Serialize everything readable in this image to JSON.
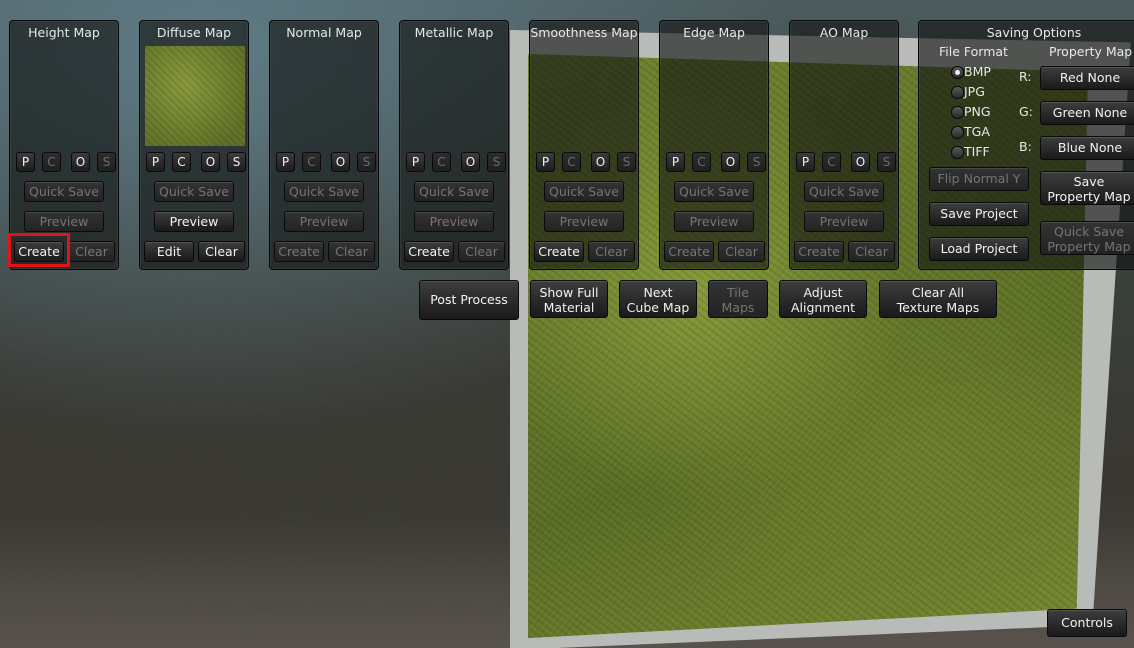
{
  "panels": [
    {
      "title": "Height Map",
      "toggles": [
        "P",
        "C",
        "O",
        "S"
      ],
      "quick_save": "Quick Save",
      "preview": "Preview",
      "create": "Create",
      "clear": "Clear"
    },
    {
      "title": "Diffuse Map",
      "toggles": [
        "P",
        "C",
        "O",
        "S"
      ],
      "quick_save": "Quick Save",
      "preview": "Preview",
      "create": "Edit",
      "clear": "Clear"
    },
    {
      "title": "Normal Map",
      "toggles": [
        "P",
        "C",
        "O",
        "S"
      ],
      "quick_save": "Quick Save",
      "preview": "Preview",
      "create": "Create",
      "clear": "Clear"
    },
    {
      "title": "Metallic Map",
      "toggles": [
        "P",
        "C",
        "O",
        "S"
      ],
      "quick_save": "Quick Save",
      "preview": "Preview",
      "create": "Create",
      "clear": "Clear"
    },
    {
      "title": "Smoothness Map",
      "toggles": [
        "P",
        "C",
        "O",
        "S"
      ],
      "quick_save": "Quick Save",
      "preview": "Preview",
      "create": "Create",
      "clear": "Clear"
    },
    {
      "title": "Edge Map",
      "toggles": [
        "P",
        "C",
        "O",
        "S"
      ],
      "quick_save": "Quick Save",
      "preview": "Preview",
      "create": "Create",
      "clear": "Clear"
    },
    {
      "title": "AO Map",
      "toggles": [
        "P",
        "C",
        "O",
        "S"
      ],
      "quick_save": "Quick Save",
      "preview": "Preview",
      "create": "Create",
      "clear": "Clear"
    }
  ],
  "saving": {
    "title": "Saving Options",
    "file_format_label": "File Format",
    "property_map_label": "Property Map",
    "formats": [
      "BMP",
      "JPG",
      "PNG",
      "TGA",
      "TIFF"
    ],
    "selected_format": "BMP",
    "channels": [
      {
        "label": "R:",
        "value": "Red None"
      },
      {
        "label": "G:",
        "value": "Green None"
      },
      {
        "label": "B:",
        "value": "Blue None"
      }
    ],
    "flip_normal_y": "Flip Normal Y",
    "save_project": "Save Project",
    "load_project": "Load Project",
    "save_property_map": [
      "Save",
      "Property Map"
    ],
    "quick_save_property_map": [
      "Quick Save",
      "Property Map"
    ]
  },
  "actions": {
    "post_process": "Post Process",
    "show_full_material": [
      "Show Full",
      "Material"
    ],
    "next_cube_map": [
      "Next",
      "Cube Map"
    ],
    "tile_maps": [
      "Tile",
      "Maps"
    ],
    "adjust_alignment": [
      "Adjust",
      "Alignment"
    ],
    "clear_all_texture_maps": [
      "Clear All",
      "Texture Maps"
    ]
  },
  "controls": "Controls",
  "colors": {
    "highlight": "#e11218",
    "panel_bg": "rgba(18,20,18,0.62)"
  }
}
